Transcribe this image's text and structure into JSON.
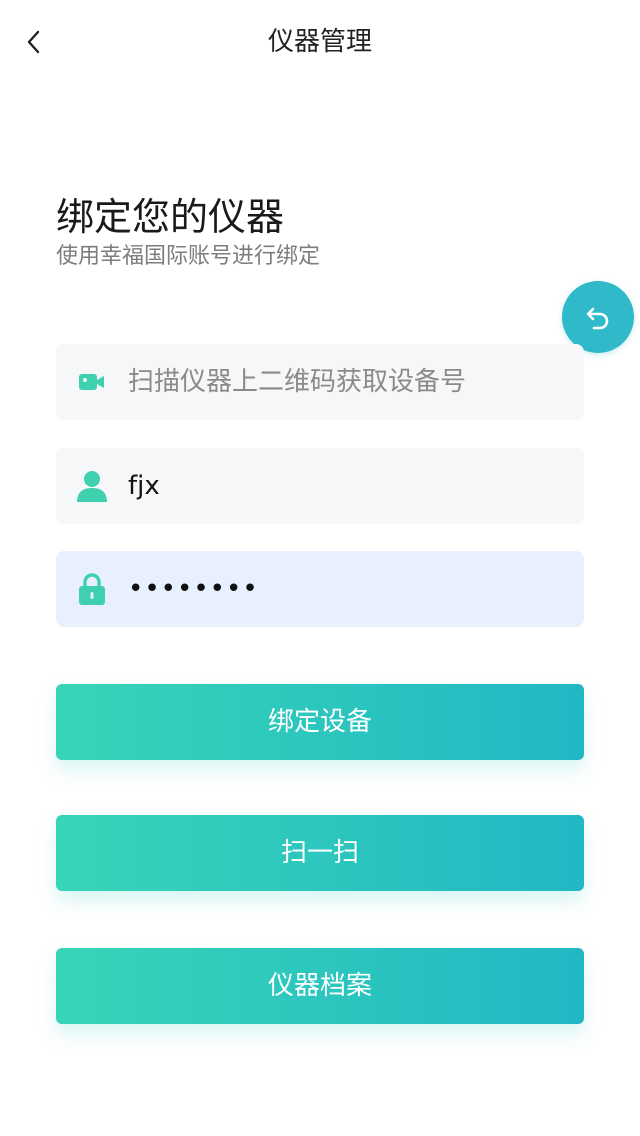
{
  "nav": {
    "title": "仪器管理",
    "back_icon": "chevron-left-icon"
  },
  "header": {
    "title": "绑定您的仪器",
    "subtitle": "使用幸福国际账号进行绑定"
  },
  "float_button": {
    "icon": "undo-icon",
    "color": "#30b9c9"
  },
  "form": {
    "device_field": {
      "placeholder": "扫描仪器上二维码获取设备号",
      "value": "",
      "icon": "video-camera-icon"
    },
    "username_field": {
      "placeholder": "",
      "value": "fjx",
      "icon": "user-icon"
    },
    "password_field": {
      "placeholder": "",
      "value": "********",
      "icon": "lock-icon"
    }
  },
  "buttons": {
    "bind": "绑定设备",
    "scan": "扫一扫",
    "archive": "仪器档案"
  },
  "colors": {
    "accent": "#36d0b8",
    "accent_end": "#21b8c4",
    "icon": "#3fd0b0"
  }
}
